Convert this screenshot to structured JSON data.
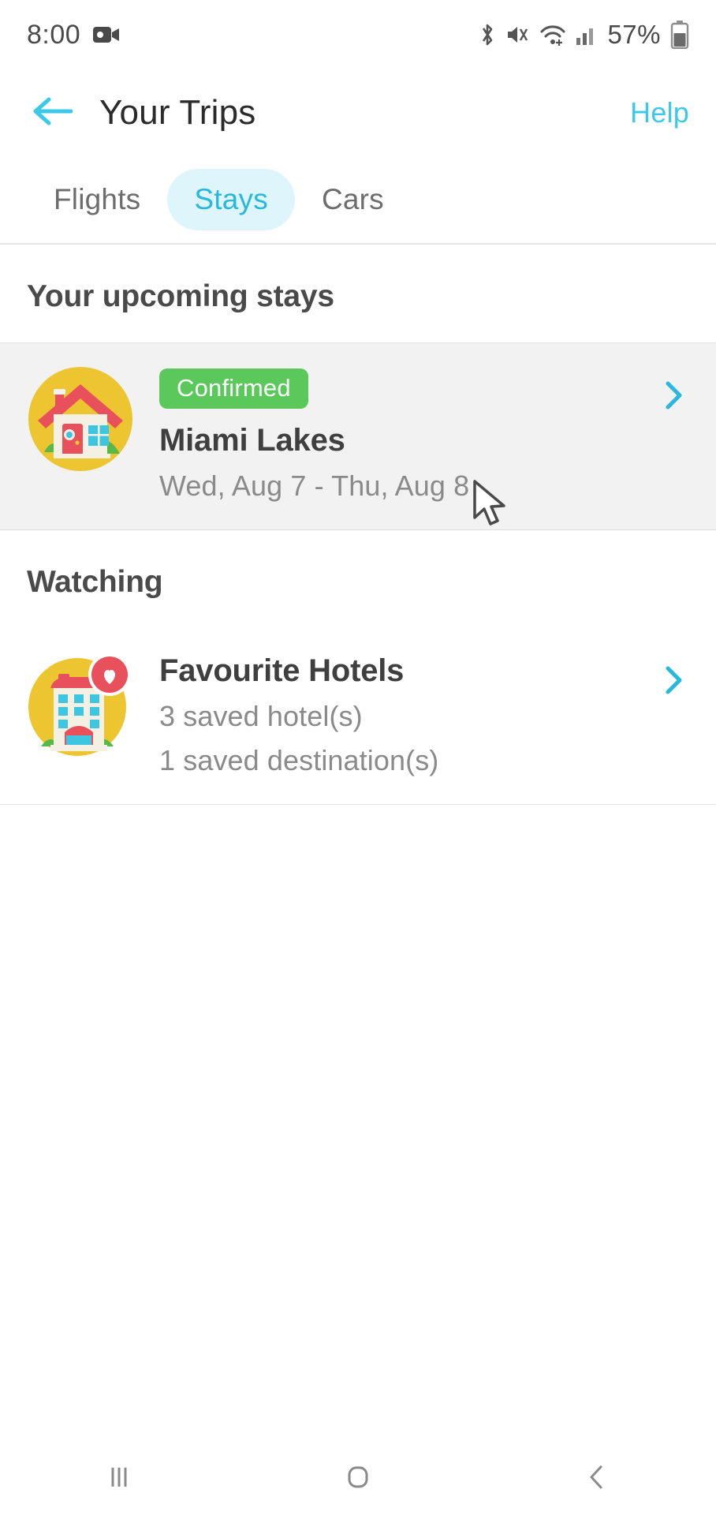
{
  "status_bar": {
    "time": "8:00",
    "battery_percent": "57%",
    "icons": [
      "screen-recorder-icon",
      "bluetooth-icon",
      "mute-icon",
      "wifi-icon",
      "cellular-signal-icon",
      "battery-icon"
    ]
  },
  "header": {
    "back_icon": "arrow-left-icon",
    "title": "Your Trips",
    "help_label": "Help",
    "accent_color": "#3cc8e8"
  },
  "tabs": [
    {
      "label": "Flights",
      "active": false
    },
    {
      "label": "Stays",
      "active": true
    },
    {
      "label": "Cars",
      "active": false
    }
  ],
  "upcoming": {
    "section_title": "Your upcoming stays",
    "items": [
      {
        "icon": "house-icon",
        "badge": "Confirmed",
        "badge_color": "#5ac85a",
        "title": "Miami Lakes",
        "dates": "Wed, Aug 7 - Thu, Aug 8",
        "chevron": "chevron-right-icon"
      }
    ]
  },
  "watching": {
    "section_title": "Watching",
    "items": [
      {
        "icon": "hotel-heart-icon",
        "title": "Favourite Hotels",
        "line1": "3 saved hotel(s)",
        "line2": "1 saved destination(s)",
        "chevron": "chevron-right-icon"
      }
    ]
  },
  "nav_bar": {
    "recents_label": "recents-icon",
    "home_label": "home-icon",
    "back_label": "back-icon"
  }
}
